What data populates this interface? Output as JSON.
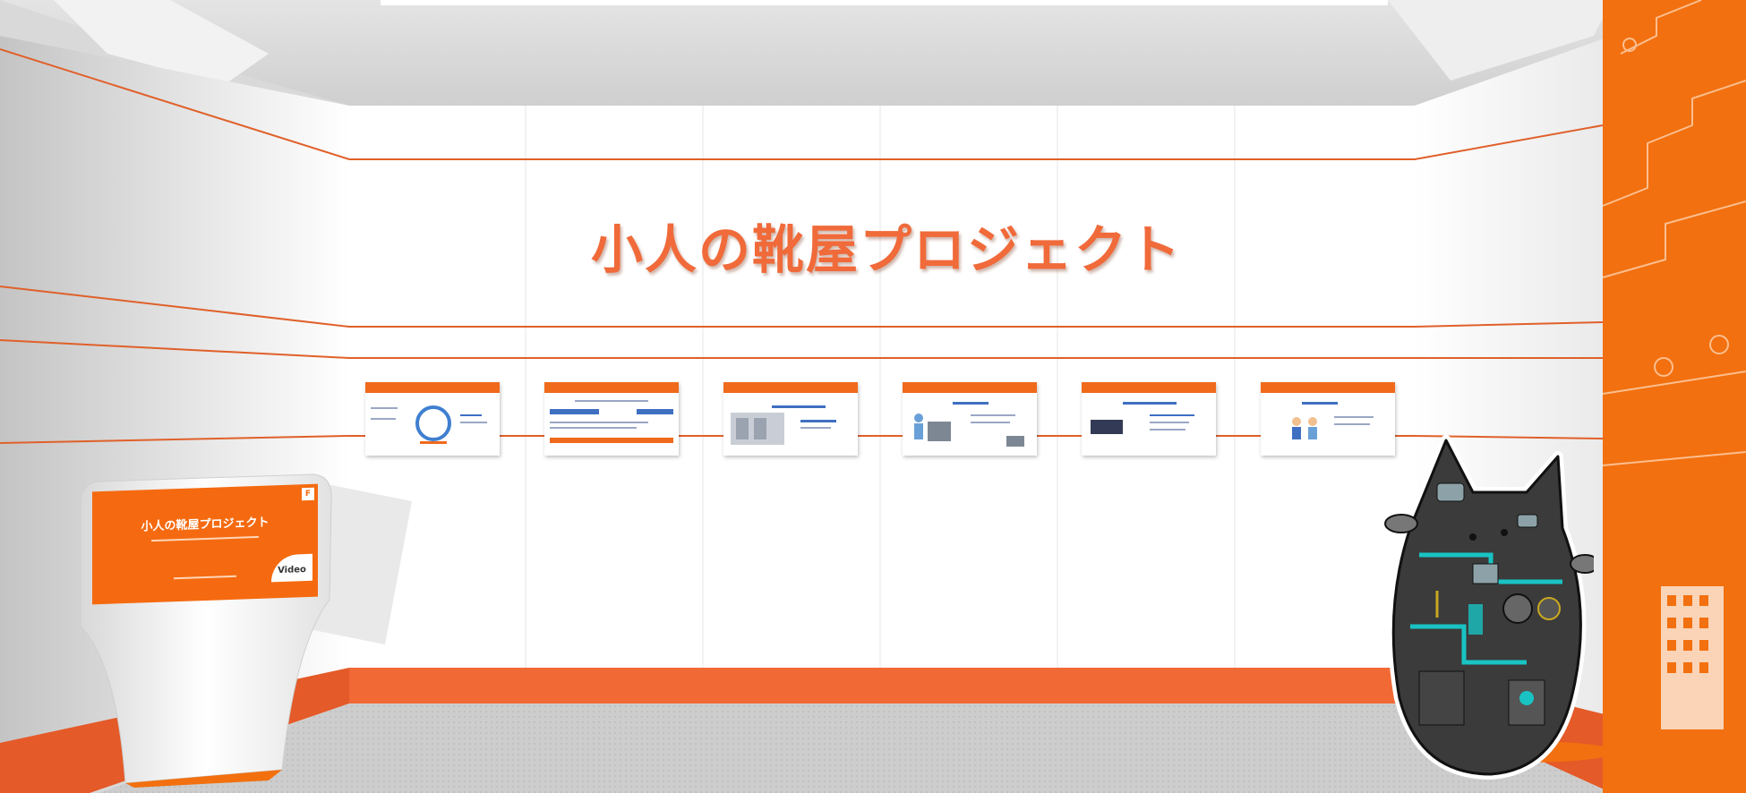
{
  "wall": {
    "title": "小人の靴屋プロジェクト",
    "colors": {
      "accent": "#f06a1c",
      "wall": "#ffffff",
      "floor": "#c9c9c9",
      "stripe": "#e0602a"
    }
  },
  "panels": [
    {
      "header": ""
    },
    {
      "header": ""
    },
    {
      "header": ""
    },
    {
      "header": ""
    },
    {
      "header": ""
    },
    {
      "header": ""
    }
  ],
  "kiosk": {
    "title": "小人の靴屋プロジェクト",
    "video_label": "Video"
  },
  "mascot": {
    "icon": "robot-cat-icon"
  }
}
